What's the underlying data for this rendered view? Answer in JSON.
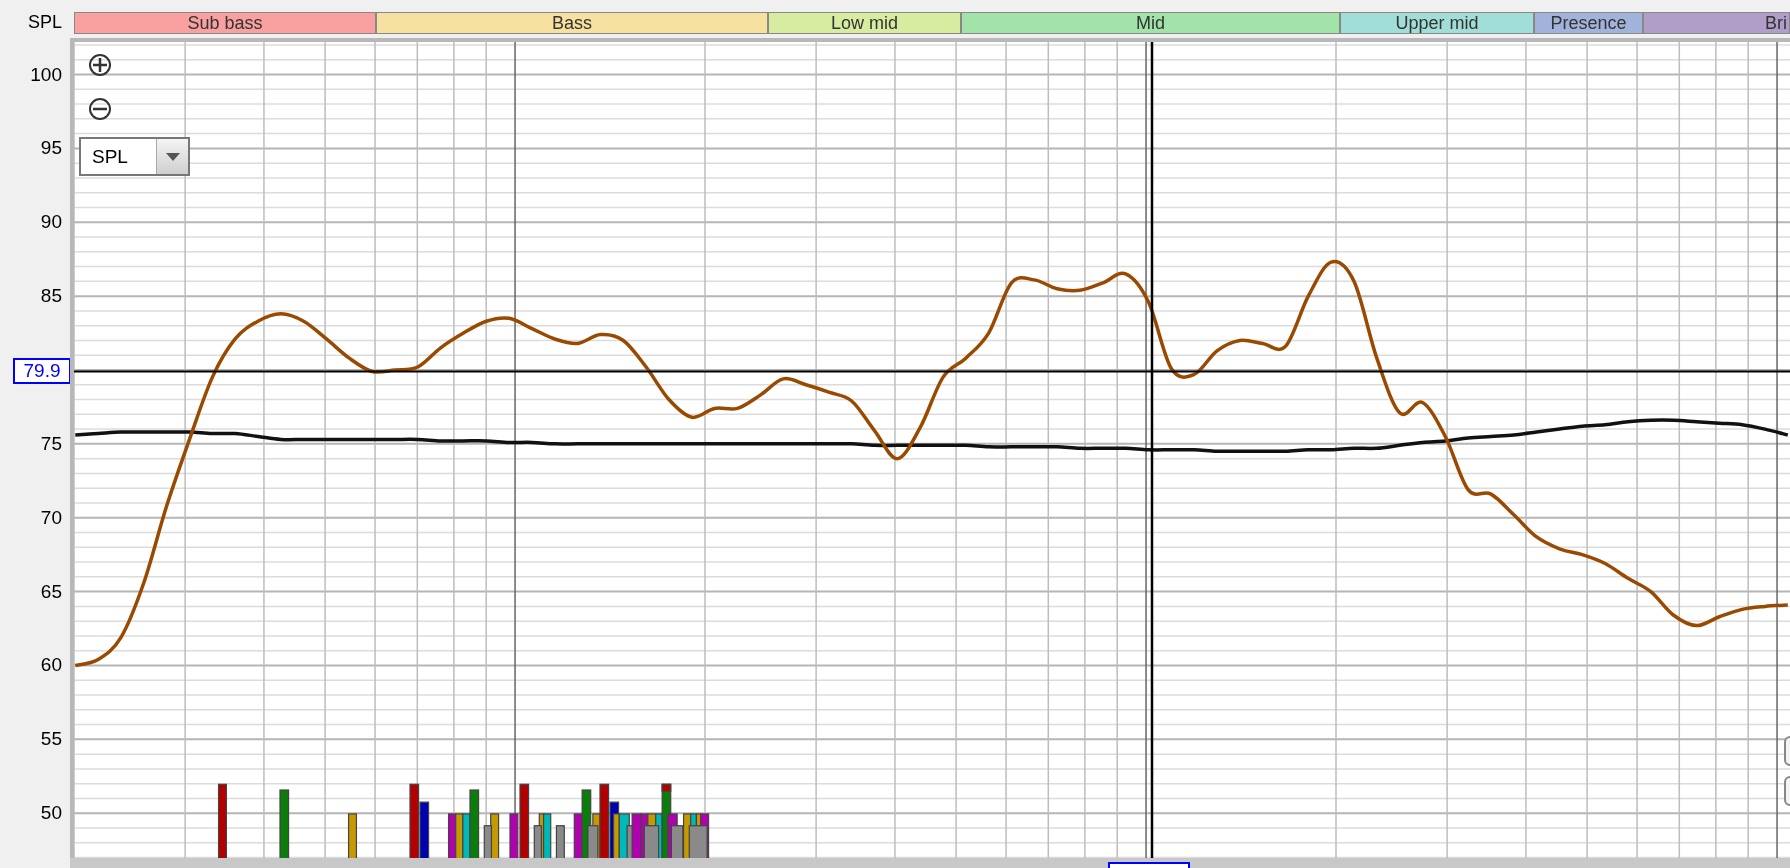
{
  "bands": [
    {
      "label": "Sub bass",
      "color": "#f9a0a0"
    },
    {
      "label": "Bass",
      "color": "#f7e1a0"
    },
    {
      "label": "Low mid",
      "color": "#d7eca1"
    },
    {
      "label": "Mid",
      "color": "#a1e3a9"
    },
    {
      "label": "Upper mid",
      "color": "#a1ded7"
    },
    {
      "label": "Presence",
      "color": "#a1b3db"
    },
    {
      "label": "Bri",
      "color": "#b09ec8"
    }
  ],
  "graph_selector": {
    "value": "SPL"
  },
  "chart_data": {
    "type": "line",
    "ylabel": "SPL",
    "ylim": [
      46.7,
      102.2
    ],
    "grid": true,
    "ref_lines": [
      {
        "axis": "y",
        "value": 79.9,
        "label": "79.9"
      }
    ],
    "yticks": [
      {
        "value": 100,
        "label": "100"
      },
      {
        "value": 95,
        "label": "95"
      },
      {
        "value": 90,
        "label": "90"
      },
      {
        "value": 85,
        "label": "85"
      },
      {
        "value": 75,
        "label": "75"
      },
      {
        "value": 70,
        "label": "70"
      },
      {
        "value": 65,
        "label": "65"
      },
      {
        "value": 60,
        "label": "60"
      },
      {
        "value": 55,
        "label": "55"
      },
      {
        "value": 50,
        "label": "50"
      }
    ],
    "series": [
      {
        "color": "#9a4a00",
        "values": [
          60.0,
          60.4,
          61.9,
          65.6,
          70.8,
          75.3,
          79.5,
          82.1,
          83.3,
          83.8,
          83.3,
          82.1,
          80.8,
          79.9,
          80.0,
          80.2,
          81.5,
          82.5,
          83.3,
          83.5,
          82.8,
          82.1,
          81.8,
          82.4,
          82.0,
          80.2,
          78.0,
          76.8,
          77.4,
          77.4,
          78.3,
          79.4,
          79.0,
          78.5,
          77.9,
          75.9,
          74.0,
          76.1,
          79.5,
          80.8,
          82.5,
          85.9,
          86.1,
          85.5,
          85.4,
          85.9,
          86.5,
          84.6,
          80.1,
          79.7,
          81.3,
          82.0,
          81.8,
          81.6,
          85.0,
          87.3,
          86.0,
          80.8,
          77.1,
          77.8,
          75.5,
          71.9,
          71.6,
          70.2,
          68.7,
          67.9,
          67.5,
          66.9,
          65.9,
          65.0,
          63.4,
          62.7,
          63.3,
          63.8,
          64.0,
          64.1
        ]
      },
      {
        "color": "#111111",
        "values": [
          75.6,
          75.7,
          75.8,
          75.8,
          75.8,
          75.8,
          75.7,
          75.7,
          75.5,
          75.3,
          75.3,
          75.3,
          75.3,
          75.3,
          75.3,
          75.3,
          75.2,
          75.2,
          75.2,
          75.1,
          75.1,
          75.0,
          75.0,
          75.0,
          75.0,
          75.0,
          75.0,
          75.0,
          75.0,
          75.0,
          75.0,
          75.0,
          75.0,
          75.0,
          75.0,
          74.9,
          74.9,
          74.9,
          74.9,
          74.9,
          74.8,
          74.8,
          74.8,
          74.8,
          74.7,
          74.7,
          74.7,
          74.6,
          74.6,
          74.6,
          74.5,
          74.5,
          74.5,
          74.5,
          74.6,
          74.6,
          74.7,
          74.7,
          74.9,
          75.1,
          75.2,
          75.4,
          75.5,
          75.6,
          75.8,
          76.0,
          76.2,
          76.3,
          76.5,
          76.6,
          76.6,
          76.5,
          76.4,
          76.3,
          76.0,
          75.6
        ]
      }
    ]
  }
}
